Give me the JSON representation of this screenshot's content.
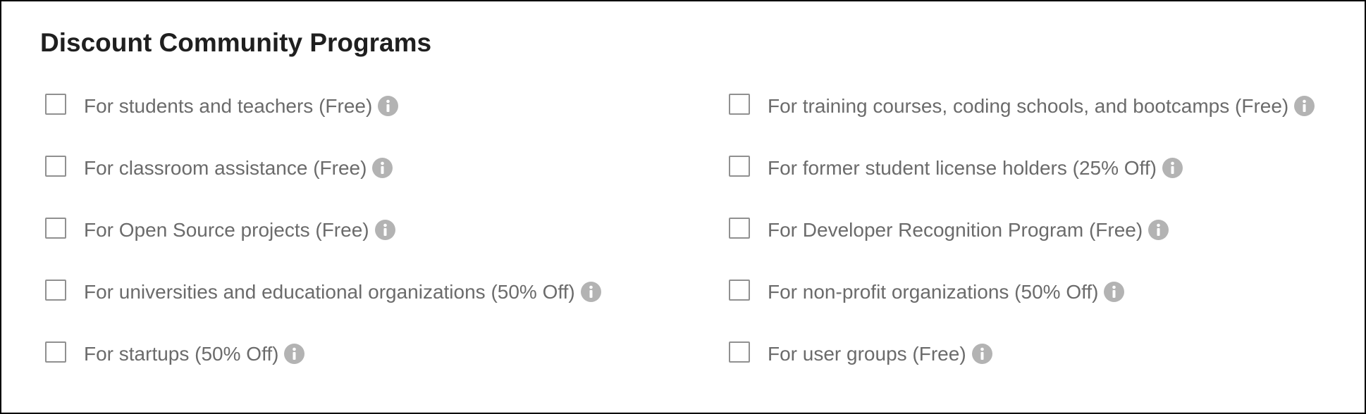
{
  "title": "Discount Community Programs",
  "left_column": [
    {
      "label": "For students and teachers (Free)",
      "checked": false,
      "icon": "info-icon"
    },
    {
      "label": "For classroom assistance (Free)",
      "checked": false,
      "icon": "info-icon"
    },
    {
      "label": "For Open Source projects (Free)",
      "checked": false,
      "icon": "info-icon"
    },
    {
      "label": "For universities and educational organizations (50% Off)",
      "checked": false,
      "icon": "info-icon"
    },
    {
      "label": "For startups (50% Off)",
      "checked": false,
      "icon": "info-icon"
    }
  ],
  "right_column": [
    {
      "label": "For training courses, coding schools, and bootcamps (Free)",
      "checked": false,
      "icon": "info-icon"
    },
    {
      "label": "For former student license holders (25% Off)",
      "checked": false,
      "icon": "info-icon"
    },
    {
      "label": "For Developer Recognition Program (Free)",
      "checked": false,
      "icon": "info-icon"
    },
    {
      "label": "For non-profit organizations (50% Off)",
      "checked": false,
      "icon": "info-icon"
    },
    {
      "label": "For user groups (Free)",
      "checked": false,
      "icon": "info-icon"
    }
  ],
  "colors": {
    "title": "#1f1f1f",
    "label": "#6b6b6b",
    "checkbox_border": "#909090",
    "info_icon": "#b3b3b3"
  }
}
